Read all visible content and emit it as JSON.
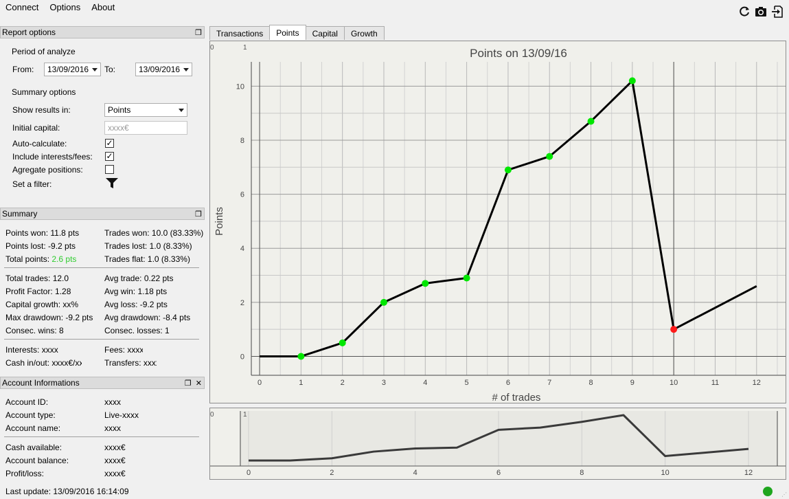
{
  "menu": [
    "Connect",
    "Options",
    "About"
  ],
  "toolbar_icons": [
    "refresh-icon",
    "camera-icon",
    "export-icon"
  ],
  "report_options": {
    "title": "Report options",
    "period_label": "Period of analyze",
    "from_label": "From:",
    "from_value": "13/09/2016",
    "to_label": "To:",
    "to_value": "13/09/2016",
    "summary_options_label": "Summary options",
    "show_results_label": "Show results in:",
    "show_results_value": "Points",
    "initial_capital_label": "Initial capital:",
    "initial_capital_placeholder": "xxxx€",
    "auto_calc_label": "Auto-calculate:",
    "auto_calc_checked": true,
    "interests_fees_label": "Include interests/fees:",
    "interests_fees_checked": true,
    "aggregate_label": "Agregate positions:",
    "aggregate_checked": false,
    "filter_label": "Set a filter:"
  },
  "summary": {
    "title": "Summary",
    "points_won": "Points won: 11.8 pts",
    "trades_won": "Trades won: 10.0 (83.33%)",
    "points_lost": "Points lost: -9.2 pts",
    "trades_lost": "Trades lost: 1.0 (8.33%)",
    "total_points_label": "Total points: ",
    "total_points_value": "2.6 pts",
    "trades_flat": "Trades flat: 1.0 (8.33%)",
    "total_trades": "Total trades: 12.0",
    "avg_trade": "Avg trade: 0.22 pts",
    "profit_factor": "Profit Factor: 1.28",
    "avg_win": "Avg win: 1.18 pts",
    "capital_growth": "Capital growth: xx%",
    "avg_loss": "Avg loss: -9.2 pts",
    "max_drawdown": "Max drawdown: -9.2 pts",
    "avg_drawdown": "Avg drawdown: -8.4 pts",
    "consec_wins": "Consec. wins: 8",
    "consec_losses": "Consec. losses: 1",
    "interests": "Interests: xxxx",
    "fees": "Fees: xxxx",
    "cash_inout": "Cash in/out: xxxx€/xx",
    "transfers": "Transfers: xxxx"
  },
  "account": {
    "title": "Account Informations",
    "id_label": "Account ID:",
    "id_value": "xxxx",
    "type_label": "Account type:",
    "type_value": "Live-xxxx",
    "name_label": "Account name:",
    "name_value": "xxxx",
    "cash_label": "Cash available:",
    "cash_value": "xxxx€",
    "balance_label": "Account balance:",
    "balance_value": "xxxx€",
    "pl_label": "Profit/loss:",
    "pl_value": "xxxx€"
  },
  "tabs": [
    "Transactions",
    "Points",
    "Capital",
    "Growth"
  ],
  "active_tab": "Points",
  "status": "Last update: 13/09/2016 16:14:09",
  "chart_data": {
    "type": "line",
    "title": "Points on 13/09/16",
    "xlabel": "# of trades",
    "ylabel": "Points",
    "x": [
      0,
      1,
      2,
      3,
      4,
      5,
      6,
      7,
      8,
      9,
      10,
      12
    ],
    "y": [
      0,
      0,
      0.5,
      2.0,
      2.7,
      2.9,
      6.9,
      7.4,
      8.7,
      10.2,
      1.0,
      2.6
    ],
    "marker_colors": [
      "none",
      "#00e600",
      "#00e600",
      "#00e600",
      "#00e600",
      "#00e600",
      "#00e600",
      "#00e600",
      "#00e600",
      "#00e600",
      "#ff1a1a",
      "none"
    ],
    "xlim": [
      -0.2,
      12.7
    ],
    "ylim": [
      -0.7,
      10.9
    ],
    "xticks": [
      0,
      1,
      2,
      3,
      4,
      5,
      6,
      7,
      8,
      9,
      10,
      11,
      12
    ],
    "yticks": [
      0,
      2,
      4,
      6,
      8,
      10
    ],
    "corner_labels": [
      "0",
      "1"
    ],
    "navigator_xticks": [
      0,
      2,
      4,
      6,
      8,
      10,
      12
    ],
    "navigator_label": "1",
    "grid": true
  }
}
